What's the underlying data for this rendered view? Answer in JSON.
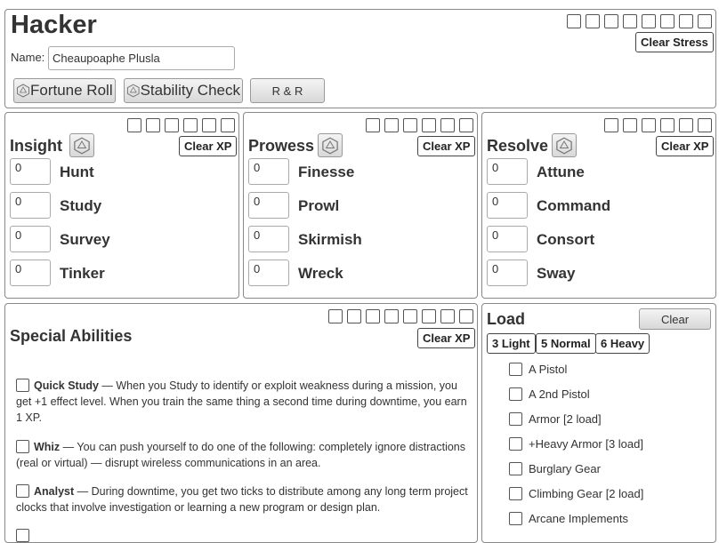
{
  "header": {
    "playbook": "Hacker",
    "name_label": "Name:",
    "name_value": "Cheaupoaphe Plusla",
    "clear_stress": "Clear Stress",
    "fortune_roll": "Fortune Roll",
    "stability_check": "Stability Check",
    "r_and_r": "R & R"
  },
  "attributes": [
    {
      "title": "Insight",
      "clear_xp": "Clear XP",
      "actions": [
        {
          "label": "Hunt",
          "value": "0"
        },
        {
          "label": "Study",
          "value": "0"
        },
        {
          "label": "Survey",
          "value": "0"
        },
        {
          "label": "Tinker",
          "value": "0"
        }
      ]
    },
    {
      "title": "Prowess",
      "clear_xp": "Clear XP",
      "actions": [
        {
          "label": "Finesse",
          "value": "0"
        },
        {
          "label": "Prowl",
          "value": "0"
        },
        {
          "label": "Skirmish",
          "value": "0"
        },
        {
          "label": "Wreck",
          "value": "0"
        }
      ]
    },
    {
      "title": "Resolve",
      "clear_xp": "Clear XP",
      "actions": [
        {
          "label": "Attune",
          "value": "0"
        },
        {
          "label": "Command",
          "value": "0"
        },
        {
          "label": "Consort",
          "value": "0"
        },
        {
          "label": "Sway",
          "value": "0"
        }
      ]
    }
  ],
  "special_abilities": {
    "title": "Special Abilities",
    "clear_xp": "Clear XP",
    "items": [
      {
        "name": "Quick Study",
        "text": " — When you Study to identify or exploit weakness during a mission, you get +1 effect level. When you train the same thing a second time during downtime, you earn 1 XP."
      },
      {
        "name": "Whiz",
        "text": " — You can push yourself to do one of the following: completely ignore distractions (real or virtual) — disrupt wireless communications in an area."
      },
      {
        "name": "Analyst",
        "text": " — During downtime, you get two ticks to distribute among any long term project clocks that involve investigation or learning a new program or design plan."
      }
    ]
  },
  "load": {
    "title": "Load",
    "clear": "Clear",
    "levels": [
      "3 Light",
      "5 Normal",
      "6 Heavy"
    ],
    "items": [
      "A Pistol",
      "A 2nd Pistol",
      "Armor [2 load]",
      "+Heavy Armor [3 load]",
      "Burglary Gear",
      "Climbing Gear [2 load]",
      "Arcane Implements"
    ]
  }
}
